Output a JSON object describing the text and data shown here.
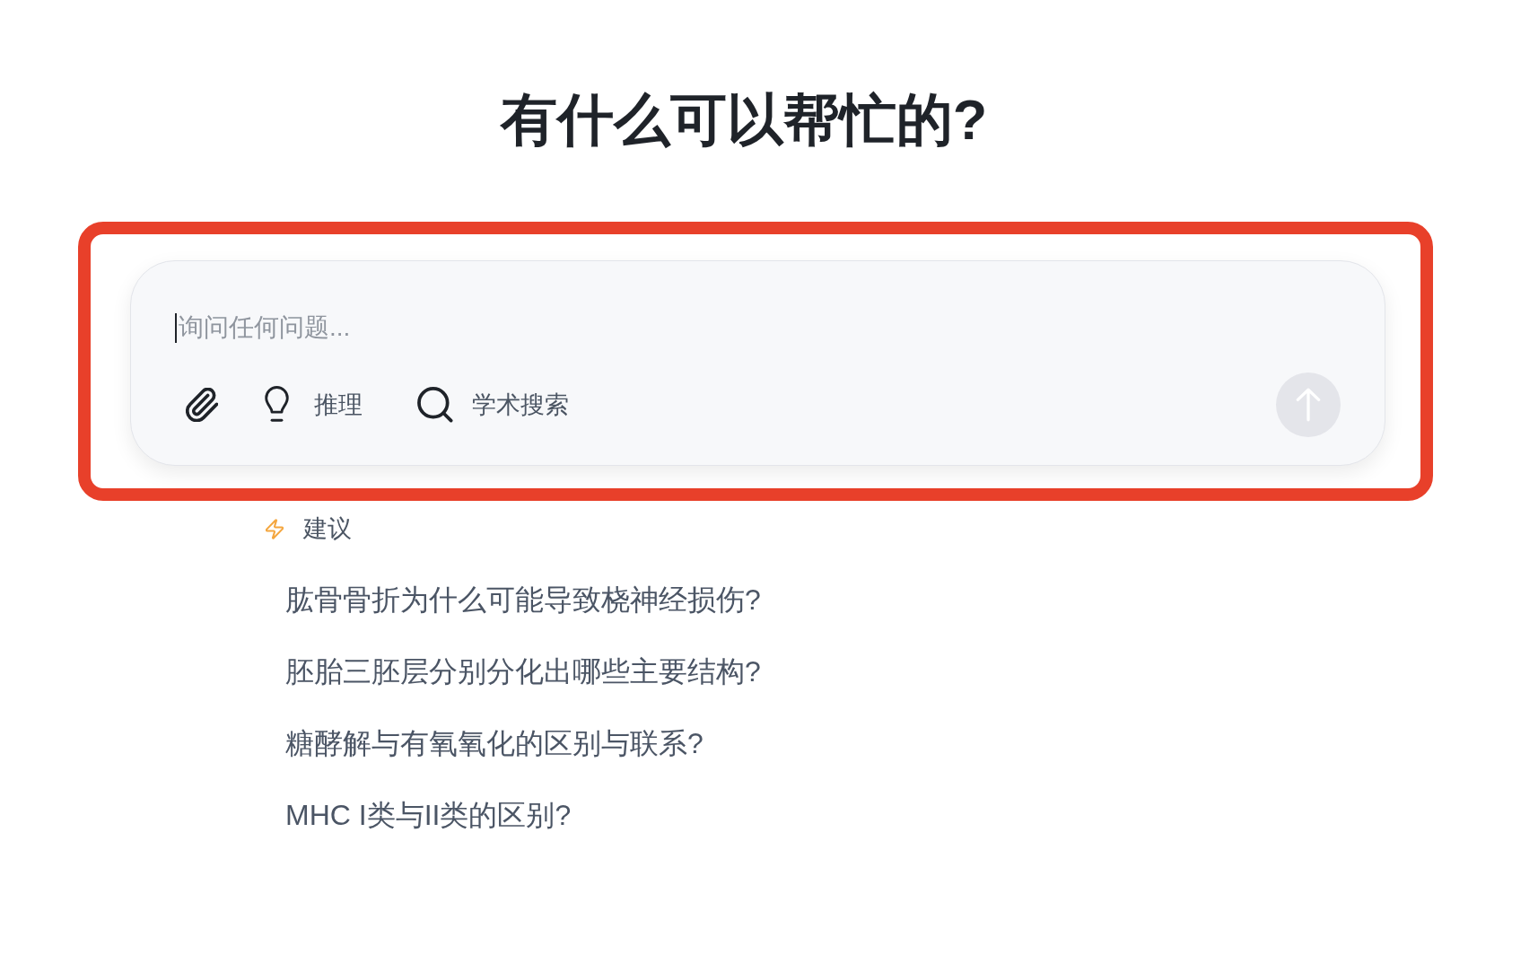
{
  "heading": "有什么可以帮忙的?",
  "composer": {
    "highlighted": true,
    "focused": true,
    "placeholder": "询问任何问题...",
    "tools": [
      {
        "kind": "attach"
      },
      {
        "kind": "reasoning",
        "label": "推理"
      },
      {
        "kind": "search",
        "label": "学术搜索"
      }
    ],
    "send_button": {
      "disabled": true
    }
  },
  "suggestions": {
    "title": "建议",
    "items": [
      "肱骨骨折为什么可能导致桡神经损伤?",
      "胚胎三胚层分别分化出哪些主要结构?",
      "糖酵解与有氧氧化的区别与联系?",
      "MHC I类与II类的区别?"
    ]
  }
}
